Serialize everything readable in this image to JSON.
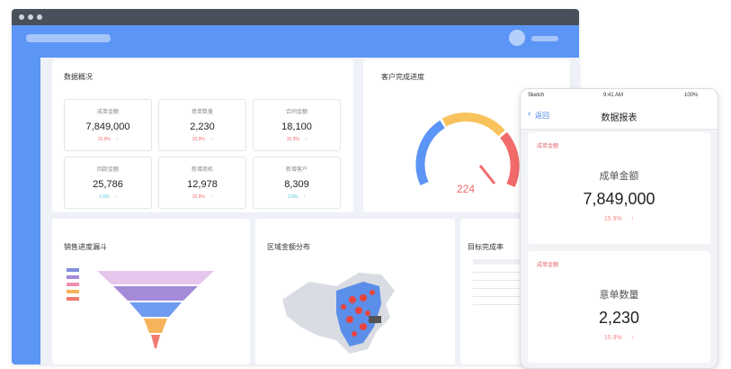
{
  "overview": {
    "title": "数据概况",
    "cards": [
      {
        "label": "成单金额",
        "value": "7,849,000",
        "change": "15.9%",
        "trend": "↑",
        "color": "#f36a6a"
      },
      {
        "label": "意单数量",
        "value": "2,230",
        "change": "15.9%",
        "trend": "↑",
        "color": "#f36a6a"
      },
      {
        "label": "合同金额",
        "value": "18,100",
        "change": "15.9%",
        "trend": "↑",
        "color": "#f36a6a"
      },
      {
        "label": "回款金额",
        "value": "25,786",
        "change": "1.6%",
        "trend": "↓",
        "color": "#4fc6de"
      },
      {
        "label": "新增商机",
        "value": "12,978",
        "change": "15.9%",
        "trend": "↑",
        "color": "#f36a6a"
      },
      {
        "label": "新增客户",
        "value": "8,309",
        "change": "3.6%",
        "trend": "↑",
        "color": "#4fc6de"
      }
    ]
  },
  "gauge": {
    "title": "客户完成进度",
    "value": "224"
  },
  "funnel": {
    "title": "销售进度漏斗",
    "legend": [
      "",
      "",
      "",
      "",
      ""
    ]
  },
  "map": {
    "title": "区域金额分布"
  },
  "table": {
    "title": "目标完成率"
  },
  "mobile": {
    "status": {
      "left": "Sketch",
      "time": "9:41 AM",
      "battery": "100%"
    },
    "back_label": "返回",
    "title": "数据报表",
    "cards": [
      {
        "tag": "成单金额",
        "label": "成单金额",
        "value": "7,849,000",
        "change": "15.9%",
        "trend": "↑"
      },
      {
        "tag": "成单金额",
        "label": "意单数量",
        "value": "2,230",
        "change": "15.9%",
        "trend": "↑"
      }
    ]
  },
  "colors": {
    "accent": "#5b95f5",
    "up": "#f36a6a",
    "down": "#4fc6de"
  }
}
